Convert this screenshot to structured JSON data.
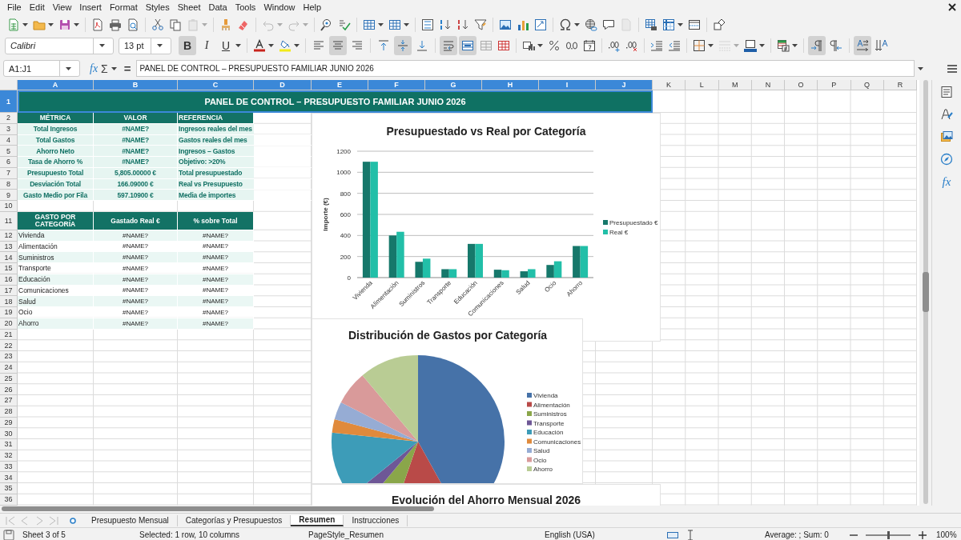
{
  "menu": [
    "File",
    "Edit",
    "View",
    "Insert",
    "Format",
    "Styles",
    "Sheet",
    "Data",
    "Tools",
    "Window",
    "Help"
  ],
  "standard_toolbar": {
    "paste_disabled": true,
    "undo_disabled": true,
    "redo_disabled": true,
    "header_footer_disabled": true
  },
  "format_toolbar": {
    "font": "Calibri",
    "size": "13 pt",
    "styles": [
      {
        "kind": "bold",
        "label": "B",
        "on": true
      },
      {
        "kind": "italic",
        "label": "I",
        "on": false
      },
      {
        "kind": "underline",
        "label": "U",
        "on": false
      }
    ],
    "align": [
      {
        "kind": "left",
        "selected": false
      },
      {
        "kind": "center",
        "selected": true
      },
      {
        "kind": "right",
        "selected": false
      }
    ],
    "valign": [
      {
        "kind": "top",
        "selected": false
      },
      {
        "kind": "center",
        "selected": true
      },
      {
        "kind": "bottom",
        "selected": false
      }
    ],
    "wrap_text": true,
    "merge_and_center": true,
    "left_to_right": true,
    "right_to_left": false,
    "text_left_to_right": true,
    "vertical_text": false,
    "border_style_disabled": true
  },
  "formula_bar": {
    "name_box": "A1:J1",
    "wizard": "fx",
    "sum": "Σ",
    "equals": "=",
    "content": "PANEL DE CONTROL – PRESUPUESTO FAMILIAR JUNIO 2026"
  },
  "sidebar": {
    "functions": "fx"
  },
  "sheet": {
    "columns": [
      {
        "label": "A",
        "selected": true
      },
      {
        "label": "B",
        "selected": true
      },
      {
        "label": "C",
        "selected": true
      },
      {
        "label": "D",
        "selected": true
      },
      {
        "label": "E",
        "selected": true
      },
      {
        "label": "F",
        "selected": true
      },
      {
        "label": "G",
        "selected": true
      },
      {
        "label": "H",
        "selected": true
      },
      {
        "label": "I",
        "selected": true
      },
      {
        "label": "J",
        "selected": true
      },
      {
        "label": "K",
        "selected": false
      },
      {
        "label": "L",
        "selected": false
      },
      {
        "label": "M",
        "selected": false
      },
      {
        "label": "N",
        "selected": false
      },
      {
        "label": "O",
        "selected": false
      },
      {
        "label": "P",
        "selected": false
      },
      {
        "label": "Q",
        "selected": false
      },
      {
        "label": "R",
        "selected": false
      }
    ],
    "rows": [
      {
        "label": "1",
        "selected": true
      },
      {
        "label": "2",
        "selected": false
      },
      {
        "label": "3",
        "selected": false
      },
      {
        "label": "4",
        "selected": false
      },
      {
        "label": "5",
        "selected": false
      },
      {
        "label": "6",
        "selected": false
      },
      {
        "label": "7",
        "selected": false
      },
      {
        "label": "8",
        "selected": false
      },
      {
        "label": "9",
        "selected": false
      },
      {
        "label": "10",
        "selected": false
      },
      {
        "label": "11",
        "selected": false
      },
      {
        "label": "12",
        "selected": false
      },
      {
        "label": "13",
        "selected": false
      },
      {
        "label": "14",
        "selected": false
      },
      {
        "label": "15",
        "selected": false
      },
      {
        "label": "16",
        "selected": false
      },
      {
        "label": "17",
        "selected": false
      },
      {
        "label": "18",
        "selected": false
      },
      {
        "label": "19",
        "selected": false
      },
      {
        "label": "20",
        "selected": false
      },
      {
        "label": "21",
        "selected": false
      },
      {
        "label": "22",
        "selected": false
      },
      {
        "label": "23",
        "selected": false
      },
      {
        "label": "24",
        "selected": false
      },
      {
        "label": "25",
        "selected": false
      },
      {
        "label": "26",
        "selected": false
      },
      {
        "label": "27",
        "selected": false
      },
      {
        "label": "28",
        "selected": false
      },
      {
        "label": "29",
        "selected": false
      },
      {
        "label": "30",
        "selected": false
      },
      {
        "label": "31",
        "selected": false
      },
      {
        "label": "32",
        "selected": false
      },
      {
        "label": "33",
        "selected": false
      },
      {
        "label": "34",
        "selected": false
      },
      {
        "label": "35",
        "selected": false
      },
      {
        "label": "36",
        "selected": false
      }
    ],
    "title": "PANEL DE CONTROL – PRESUPUESTO FAMILIAR JUNIO 2026",
    "metrics_header": [
      "MÉTRICA",
      "VALOR",
      "REFERENCIA"
    ],
    "metrics": [
      {
        "metric": "Total Ingresos",
        "value": "#NAME?",
        "reference": "Ingresos reales del mes"
      },
      {
        "metric": "Total Gastos",
        "value": "#NAME?",
        "reference": "Gastos reales del mes"
      },
      {
        "metric": "Ahorro Neto",
        "value": "#NAME?",
        "reference": "Ingresos – Gastos"
      },
      {
        "metric": "Tasa de Ahorro %",
        "value": "#NAME?",
        "reference": "Objetivo: >20%"
      },
      {
        "metric": "Presupuesto Total",
        "value": "5,805.00000 €",
        "reference": "Total presupuestado"
      },
      {
        "metric": "Desviación Total",
        "value": "166.09000 €",
        "reference": "Real vs Presupuesto"
      },
      {
        "metric": "Gasto Medio por Fila",
        "value": "597.10900 €",
        "reference": "Media de importes"
      }
    ],
    "category_header": [
      "GASTO POR CATEGORÍA",
      "Gastado Real €",
      "% sobre Total"
    ],
    "categories": [
      {
        "name": "Vivienda",
        "spent": "#NAME?",
        "share": "#NAME?"
      },
      {
        "name": "Alimentación",
        "spent": "#NAME?",
        "share": "#NAME?"
      },
      {
        "name": "Suministros",
        "spent": "#NAME?",
        "share": "#NAME?"
      },
      {
        "name": "Transporte",
        "spent": "#NAME?",
        "share": "#NAME?"
      },
      {
        "name": "Educación",
        "spent": "#NAME?",
        "share": "#NAME?"
      },
      {
        "name": "Comunicaciones",
        "spent": "#NAME?",
        "share": "#NAME?"
      },
      {
        "name": "Salud",
        "spent": "#NAME?",
        "share": "#NAME?"
      },
      {
        "name": "Ocio",
        "spent": "#NAME?",
        "share": "#NAME?"
      },
      {
        "name": "Ahorro",
        "spent": "#NAME?",
        "share": "#NAME?"
      }
    ]
  },
  "charts": [
    {
      "chart_data": {
        "type": "bar",
        "title": "Presupuestado vs Real por Categoría",
        "ylabel": "Importe (€)",
        "categories": [
          "Vivienda",
          "Alimentación",
          "Suministros",
          "Transporte",
          "Educación",
          "Comunicaciones",
          "Salud",
          "Ocio",
          "Ahorro"
        ],
        "series": [
          {
            "name": "Presupuestado €",
            "color": "#16786b",
            "values": [
              1100,
              400,
              150,
              80,
              320,
              75,
              60,
              120,
              300
            ]
          },
          {
            "name": "Real €",
            "color": "#22bfa8",
            "values": [
              1100,
              435,
              180,
              80,
              320,
              70,
              80,
              155,
              300
            ]
          }
        ],
        "ylim": [
          0,
          1200
        ],
        "yticks": [
          0,
          200,
          400,
          600,
          800,
          1000,
          1200
        ],
        "grid": true,
        "legend": true
      }
    },
    {
      "title": "Distribución de Gastos por Categoría",
      "kind": "picture",
      "legend": [
        {
          "label": "Vivienda",
          "color": "#4672a8"
        },
        {
          "label": "Alimentación",
          "color": "#b94a48"
        },
        {
          "label": "Suministros",
          "color": "#8aa64a"
        },
        {
          "label": "Transporte",
          "color": "#6e5796"
        },
        {
          "label": "Educación",
          "color": "#3d9cb8"
        },
        {
          "label": "Comunicaciones",
          "color": "#e08a3c"
        },
        {
          "label": "Salud",
          "color": "#96acd4"
        },
        {
          "label": "Ocio",
          "color": "#d99a9a"
        },
        {
          "label": "Ahorro",
          "color": "#b9cc94"
        }
      ]
    },
    {
      "title": "Evolución del Ahorro Mensual 2026"
    }
  ],
  "sheet_tabs": [
    {
      "label": "Presupuesto Mensual",
      "selected": false
    },
    {
      "label": "Categorías y Presupuestos",
      "selected": false
    },
    {
      "label": "Resumen",
      "selected": true
    },
    {
      "label": "Instrucciones",
      "selected": false
    }
  ],
  "status_bar": {
    "sheet": "Sheet 3 of 5",
    "selection": "Selected: 1 row, 10 columns",
    "page_style": "PageStyle_Resumen",
    "language": "English (USA)",
    "summary": "Average: ; Sum: 0",
    "zoom_slider": {
      "level": 0.5
    },
    "zoom": "100%"
  }
}
